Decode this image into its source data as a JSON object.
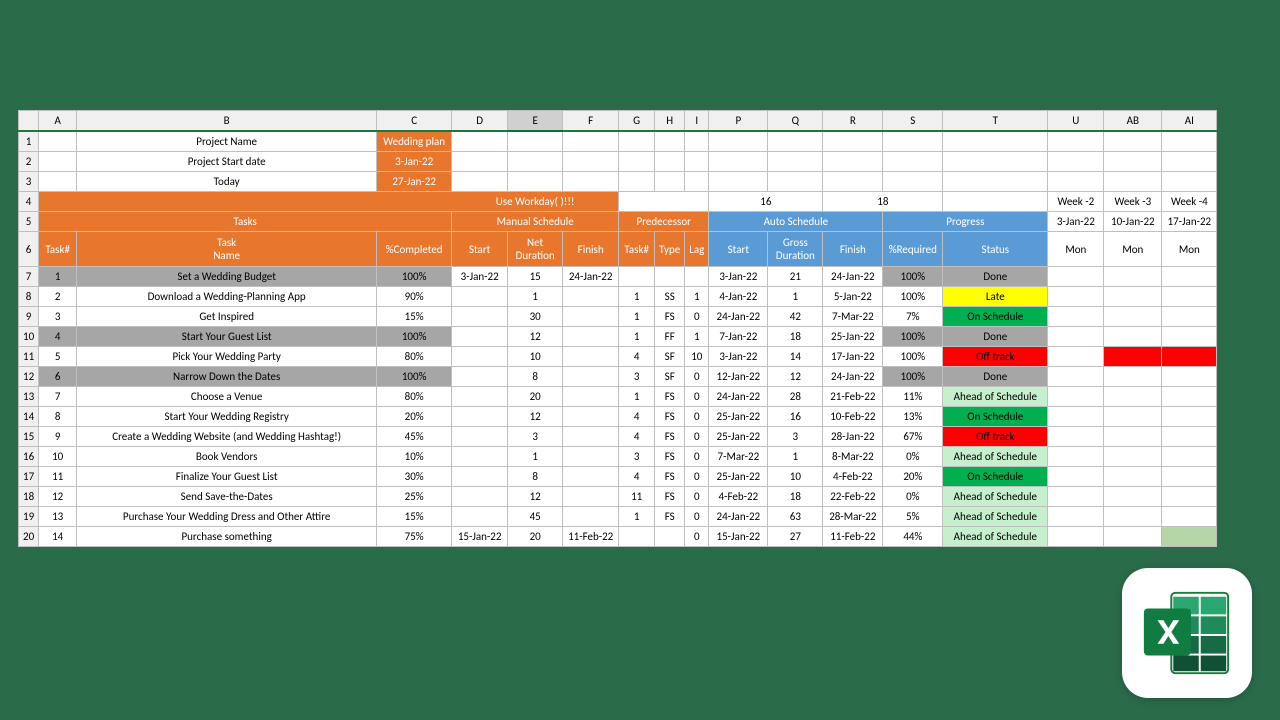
{
  "columns": [
    "A",
    "B",
    "C",
    "D",
    "E",
    "F",
    "G",
    "H",
    "I",
    "P",
    "Q",
    "R",
    "S",
    "T",
    "U",
    "AB",
    "AI"
  ],
  "meta": {
    "r1": {
      "label": "Project Name",
      "value": "Wedding plan"
    },
    "r2": {
      "label": "Project Start date",
      "value": "3-Jan-22"
    },
    "r3": {
      "label": "Today",
      "value": "27-Jan-22"
    }
  },
  "row4": {
    "hint": "Use Workday( )!!!",
    "num1": "16",
    "num2": "18",
    "weeks": [
      "Week -2",
      "Week -3",
      "Week -4"
    ]
  },
  "row5": {
    "tasks": "Tasks",
    "manual": "Manual Schedule",
    "pred": "Predecessor",
    "auto": "Auto Schedule",
    "progress": "Progress",
    "dates": [
      "3-Jan-22",
      "10-Jan-22",
      "17-Jan-22"
    ]
  },
  "headers": {
    "A": "Task#",
    "B": "Task Name",
    "C": "%Completed",
    "D": "Start",
    "E": "Net Duration",
    "F": "Finish",
    "G": "Task#",
    "H": "Type",
    "I": "Lag",
    "P": "Start",
    "Q": "Gross Duration",
    "R": "Finish",
    "S": "%Required",
    "T": "Status",
    "U": "Mon",
    "AB": "Mon",
    "AI": "Mon"
  },
  "tasks": [
    {
      "rn": "7",
      "n": "1",
      "name": "Set a Wedding Budget",
      "pct": "100%",
      "mstart": "3-Jan-22",
      "mdur": "15",
      "mfin": "24-Jan-22",
      "pt": "",
      "ptype": "",
      "plag": "",
      "as": "3-Jan-22",
      "gd": "21",
      "af": "24-Jan-22",
      "req": "100%",
      "status": "Done",
      "scls": "grey-done",
      "done": true
    },
    {
      "rn": "8",
      "n": "2",
      "name": "Download a Wedding-Planning App",
      "pct": "90%",
      "mstart": "",
      "mdur": "1",
      "mfin": "",
      "pt": "1",
      "ptype": "SS",
      "plag": "1",
      "as": "4-Jan-22",
      "gd": "1",
      "af": "5-Jan-22",
      "req": "100%",
      "status": "Late",
      "scls": "yellow"
    },
    {
      "rn": "9",
      "n": "3",
      "name": "Get Inspired",
      "pct": "15%",
      "mstart": "",
      "mdur": "30",
      "mfin": "",
      "pt": "1",
      "ptype": "FS",
      "plag": "0",
      "as": "24-Jan-22",
      "gd": "42",
      "af": "7-Mar-22",
      "req": "7%",
      "status": "On Schedule",
      "scls": "green-on"
    },
    {
      "rn": "10",
      "n": "4",
      "name": "Start Your Guest List",
      "pct": "100%",
      "mstart": "",
      "mdur": "12",
      "mfin": "",
      "pt": "1",
      "ptype": "FF",
      "plag": "1",
      "as": "7-Jan-22",
      "gd": "18",
      "af": "25-Jan-22",
      "req": "100%",
      "status": "Done",
      "scls": "grey-done",
      "done": true
    },
    {
      "rn": "11",
      "n": "5",
      "name": "Pick Your Wedding Party",
      "pct": "80%",
      "mstart": "",
      "mdur": "10",
      "mfin": "",
      "pt": "4",
      "ptype": "SF",
      "plag": "10",
      "as": "3-Jan-22",
      "gd": "14",
      "af": "17-Jan-22",
      "req": "100%",
      "status": "Off track",
      "scls": "red-off",
      "redweek": true
    },
    {
      "rn": "12",
      "n": "6",
      "name": "Narrow Down the Dates",
      "pct": "100%",
      "mstart": "",
      "mdur": "8",
      "mfin": "",
      "pt": "3",
      "ptype": "SF",
      "plag": "0",
      "as": "12-Jan-22",
      "gd": "12",
      "af": "24-Jan-22",
      "req": "100%",
      "status": "Done",
      "scls": "grey-done",
      "done": true
    },
    {
      "rn": "13",
      "n": "7",
      "name": "Choose a Venue",
      "pct": "80%",
      "mstart": "",
      "mdur": "20",
      "mfin": "",
      "pt": "1",
      "ptype": "FS",
      "plag": "0",
      "as": "24-Jan-22",
      "gd": "28",
      "af": "21-Feb-22",
      "req": "11%",
      "status": "Ahead of Schedule",
      "scls": "lightgreen"
    },
    {
      "rn": "14",
      "n": "8",
      "name": "Start Your Wedding Registry",
      "pct": "20%",
      "mstart": "",
      "mdur": "12",
      "mfin": "",
      "pt": "4",
      "ptype": "FS",
      "plag": "0",
      "as": "25-Jan-22",
      "gd": "16",
      "af": "10-Feb-22",
      "req": "13%",
      "status": "On Schedule",
      "scls": "green-on"
    },
    {
      "rn": "15",
      "n": "9",
      "name": "Create a Wedding Website (and Wedding Hashtag!)",
      "pct": "45%",
      "mstart": "",
      "mdur": "3",
      "mfin": "",
      "pt": "4",
      "ptype": "FS",
      "plag": "0",
      "as": "25-Jan-22",
      "gd": "3",
      "af": "28-Jan-22",
      "req": "67%",
      "status": "Off track",
      "scls": "red-off"
    },
    {
      "rn": "16",
      "n": "10",
      "name": "Book Vendors",
      "pct": "10%",
      "mstart": "",
      "mdur": "1",
      "mfin": "",
      "pt": "3",
      "ptype": "FS",
      "plag": "0",
      "as": "7-Mar-22",
      "gd": "1",
      "af": "8-Mar-22",
      "req": "0%",
      "status": "Ahead of Schedule",
      "scls": "lightgreen"
    },
    {
      "rn": "17",
      "n": "11",
      "name": "Finalize Your Guest List",
      "pct": "30%",
      "mstart": "",
      "mdur": "8",
      "mfin": "",
      "pt": "4",
      "ptype": "FS",
      "plag": "0",
      "as": "25-Jan-22",
      "gd": "10",
      "af": "4-Feb-22",
      "req": "20%",
      "status": "On Schedule",
      "scls": "green-on"
    },
    {
      "rn": "18",
      "n": "12",
      "name": "Send Save-the-Dates",
      "pct": "25%",
      "mstart": "",
      "mdur": "12",
      "mfin": "",
      "pt": "11",
      "ptype": "FS",
      "plag": "0",
      "as": "4-Feb-22",
      "gd": "18",
      "af": "22-Feb-22",
      "req": "0%",
      "status": "Ahead of Schedule",
      "scls": "lightgreen"
    },
    {
      "rn": "19",
      "n": "13",
      "name": "Purchase Your Wedding Dress and Other Attire",
      "pct": "15%",
      "mstart": "",
      "mdur": "45",
      "mfin": "",
      "pt": "1",
      "ptype": "FS",
      "plag": "0",
      "as": "24-Jan-22",
      "gd": "63",
      "af": "28-Mar-22",
      "req": "5%",
      "status": "Ahead of Schedule",
      "scls": "lightgreen"
    },
    {
      "rn": "20",
      "n": "14",
      "name": "Purchase something",
      "pct": "75%",
      "mstart": "15-Jan-22",
      "mdur": "20",
      "mfin": "11-Feb-22",
      "pt": "",
      "ptype": "",
      "plag": "0",
      "as": "15-Jan-22",
      "gd": "27",
      "af": "11-Feb-22",
      "req": "44%",
      "status": "Ahead of Schedule",
      "scls": "lightgreen",
      "lastgreen": true
    }
  ]
}
